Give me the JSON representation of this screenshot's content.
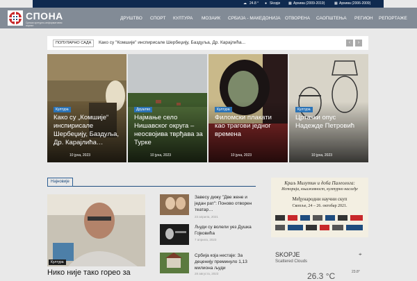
{
  "topbar": {
    "temperature": "24.8 °",
    "city": "Skopje",
    "archive1": "Архива (2009-2019)",
    "archive2": "Архива (2006-2009)"
  },
  "brand": {
    "name": "СПОНА",
    "tagline": "Српски културно-информативни портал"
  },
  "nav": {
    "items": [
      "ДРУШТВО",
      "СПОРТ",
      "КУЛТУРА",
      "МОЗАИК",
      "СРБИЈА - МАКЕДОНИЈА",
      "ОТВОРЕНА",
      "САОПШТЕЊА",
      "РЕГИОН",
      "РЕПОРТАЖЕ"
    ]
  },
  "ticker": {
    "badge": "ПОПУЛАРНО САДА",
    "text": "Како су \"Комшије\" инспирисале Шербеџију, Баздуља, Др. Карајлића..."
  },
  "featured": [
    {
      "category": "Култура",
      "title": "Како су „Комшије“ инспирисале Шербеџију, Баздуља, Др. Карајлића…",
      "date": "10 јуна, 2023"
    },
    {
      "category": "Друштво",
      "title": "Најмање село Нишавског округа – неосвојива тврђава за Турке",
      "date": "10 јуна, 2023"
    },
    {
      "category": "Култура",
      "title": "Филомски плакати као трагови једног времена",
      "date": "10 јуна, 2023"
    },
    {
      "category": "Култура",
      "title": "Цртачки опус Надежде Петровић",
      "date": "10 јуна, 2023"
    }
  ],
  "latest": {
    "label": "Најновије",
    "main": {
      "category": "Култура",
      "title": "Нико није тако горео за"
    },
    "side": [
      {
        "title": "Завесу дижу \"Две жене и један рат\": Поново отворен театар…",
        "date": "23 априла, 2021"
      },
      {
        "title": "Људи су волели уез Душка Гојковића",
        "date": "7 априла, 2023"
      },
      {
        "title": "Србија која нестаје: За деценију преминуло 1,13 милиона људи",
        "date": "28 августа, 2023"
      }
    ]
  },
  "ad": {
    "line1": "Краљ Милутин и доба Палеолога:",
    "line2": "Историја, књижевност, културно наслеђе",
    "line3": "Међународни научни скуп",
    "line4": "Скопље, 24 – 26. октобар 2021."
  },
  "weather": {
    "city": "SKOPJE",
    "desc": "Scattered Clouds",
    "temp": "26.3 °C",
    "small_temp": "23.8°"
  },
  "colors": {
    "topbar": "#0f2a4f",
    "nav": "#828b96",
    "accent": "#2b73b6"
  }
}
